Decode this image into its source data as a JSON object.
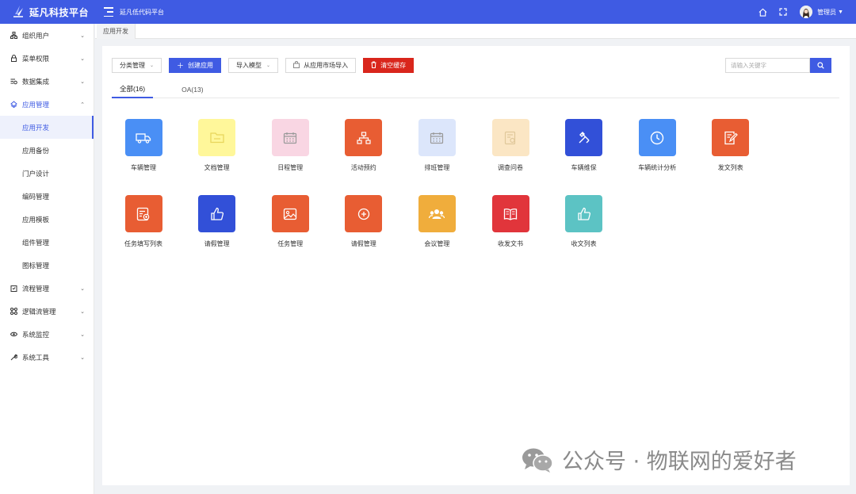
{
  "header": {
    "brand_title": "延凡科技平台",
    "subtitle": "延凡低代码平台",
    "user_name": "管理员",
    "bg_color": "#3f5be3"
  },
  "sidebar": {
    "items": [
      {
        "label": "组织用户",
        "icon": "org-icon",
        "expanded": false
      },
      {
        "label": "菜单权限",
        "icon": "lock-icon",
        "expanded": false
      },
      {
        "label": "数据集成",
        "icon": "data-icon",
        "expanded": false
      },
      {
        "label": "应用管理",
        "icon": "app-icon",
        "expanded": true,
        "children": [
          "应用开发",
          "应用备份",
          "门户设计",
          "编码管理",
          "应用模板",
          "组件管理",
          "图标管理"
        ],
        "active_child": "应用开发"
      },
      {
        "label": "流程管理",
        "icon": "flow-icon",
        "expanded": false
      },
      {
        "label": "逻辑流管理",
        "icon": "logic-icon",
        "expanded": false
      },
      {
        "label": "系统监控",
        "icon": "eye-icon",
        "expanded": false
      },
      {
        "label": "系统工具",
        "icon": "tool-icon",
        "expanded": false
      }
    ]
  },
  "breadcrumb_tab": "应用开发",
  "toolbar": {
    "category": "分类管理",
    "create": "创建应用",
    "import_model": "导入模型",
    "market_import": "从应用市场导入",
    "clear_cache": "清空缓存"
  },
  "search": {
    "placeholder": "请输入关键字"
  },
  "tabs": [
    {
      "label": "全部(16)",
      "active": true
    },
    {
      "label": "OA(13)",
      "active": false
    }
  ],
  "apps": [
    {
      "label": "车辆管理",
      "color": "#4a8ff5",
      "icon": "truck-icon"
    },
    {
      "label": "文档管理",
      "color": "#fff79a",
      "icon": "folder-icon"
    },
    {
      "label": "日程管理",
      "color": "#f9d6e3",
      "icon": "calendar-icon"
    },
    {
      "label": "活动预约",
      "color": "#e85d33",
      "icon": "org-chart-icon"
    },
    {
      "label": "排班管理",
      "color": "#dce6fb",
      "icon": "calendar-icon"
    },
    {
      "label": "调查问卷",
      "color": "#fbe6c4",
      "icon": "survey-icon"
    },
    {
      "label": "车辆维保",
      "color": "#3250d8",
      "icon": "wrench-icon"
    },
    {
      "label": "车辆统计分析",
      "color": "#4a8ff5",
      "icon": "clock-icon"
    },
    {
      "label": "发文列表",
      "color": "#e85d33",
      "icon": "edit-doc-icon"
    },
    {
      "label": "任务填写列表",
      "color": "#e85d33",
      "icon": "form-icon"
    },
    {
      "label": "请假管理",
      "color": "#3250d8",
      "icon": "thumb-up-icon"
    },
    {
      "label": "任务管理",
      "color": "#e85d33",
      "icon": "image-icon"
    },
    {
      "label": "请假管理",
      "color": "#e85d33",
      "icon": "plus-circle-icon"
    },
    {
      "label": "会议管理",
      "color": "#f0ad3c",
      "icon": "people-icon"
    },
    {
      "label": "收发文书",
      "color": "#e1353b",
      "icon": "book-icon"
    },
    {
      "label": "收文列表",
      "color": "#5cc3c4",
      "icon": "thumb-up-icon"
    }
  ],
  "watermark": "公众号 · 物联网的爱好者"
}
